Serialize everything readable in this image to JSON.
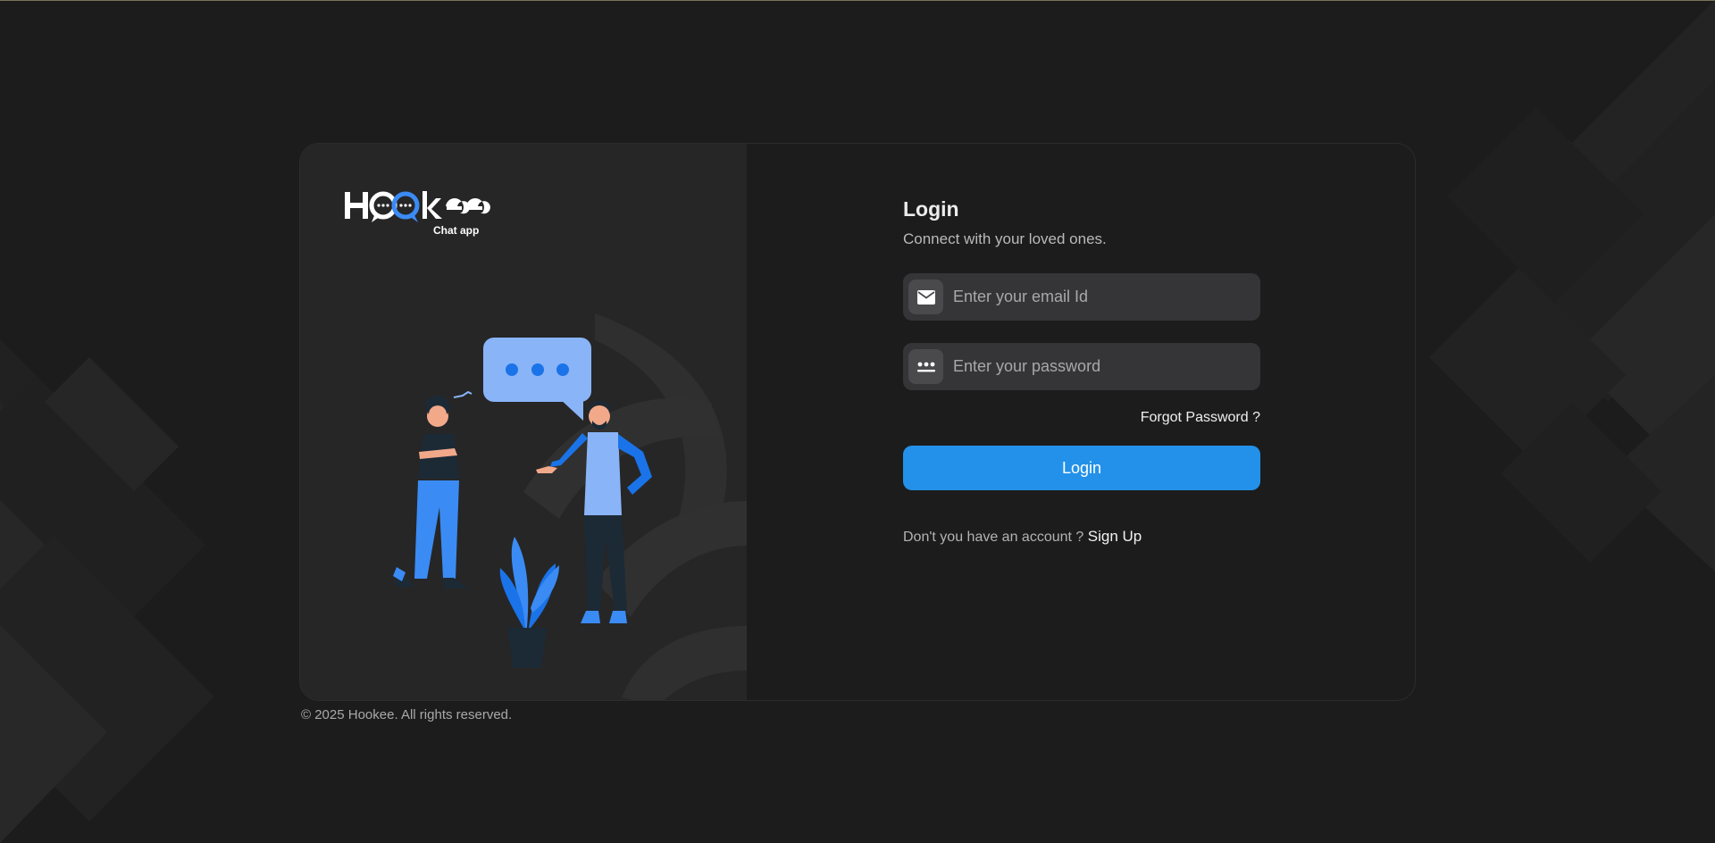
{
  "brand": {
    "logo_text": "Hookee",
    "logo_subtitle": "Chat app"
  },
  "login": {
    "title": "Login",
    "subtitle": "Connect with your loved ones.",
    "email_placeholder": "Enter your email Id",
    "email_value": "",
    "email_icon": "envelope-icon",
    "password_placeholder": "Enter your password",
    "password_value": "",
    "password_icon": "password-dots-icon",
    "forgot_label": "Forgot Password ?",
    "submit_label": "Login",
    "signup_prompt": "Don't you have an account ?",
    "signup_label": "Sign Up"
  },
  "footer": {
    "copyright": "© 2025 Hookee. All rights reserved."
  },
  "colors": {
    "background": "#1c1c1c",
    "panel": "#262626",
    "field": "#353538",
    "accent": "#2391e9",
    "illustration_blue": "#3b8bf5"
  }
}
